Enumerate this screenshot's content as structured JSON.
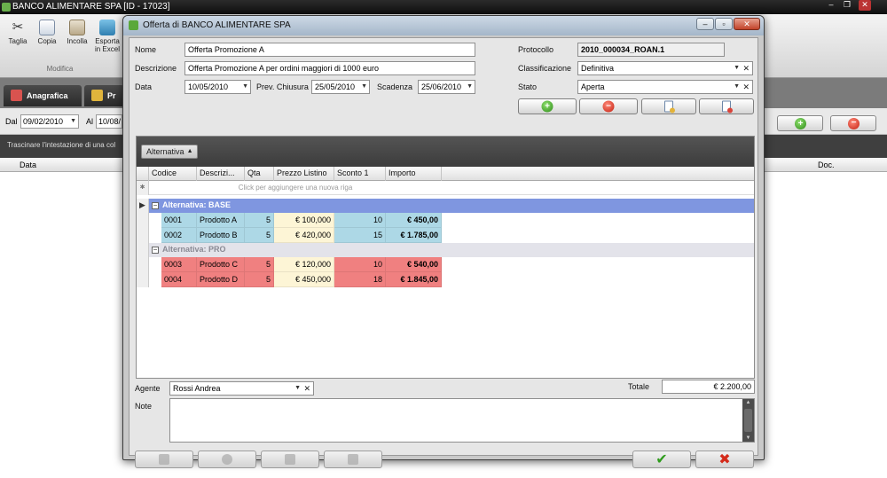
{
  "main_window": {
    "title": "BANCO ALIMENTARE SPA [ID - 17023]",
    "toolbar": {
      "taglia": "Taglia",
      "copia": "Copia",
      "incolla": "Incolla",
      "esporta_l1": "Esporta",
      "esporta_l2": "in Excel",
      "group_label": "Modifica"
    },
    "tabs": {
      "anagrafica": "Anagrafica",
      "second": "Pr"
    },
    "filter": {
      "dal_label": "Dal",
      "dal_value": "09/02/2010",
      "al_label": "Al",
      "al_value": "10/08/"
    },
    "group_hint": "Trascinare l'intestazione di una col",
    "columns": {
      "data": "Data",
      "doc": "Doc."
    }
  },
  "dialog": {
    "title": "Offerta di BANCO ALIMENTARE SPA",
    "nome_label": "Nome",
    "nome_value": "Offerta Promozione A",
    "descrizione_label": "Descrizione",
    "descrizione_value": "Offerta Promozione A per ordini maggiori di 1000 euro",
    "data_label": "Data",
    "data_value": "10/05/2010",
    "prev_chiusura_label": "Prev. Chiusura",
    "prev_chiusura_value": "25/05/2010",
    "scadenza_label": "Scadenza",
    "scadenza_value": "25/06/2010",
    "protocollo_label": "Protocollo",
    "protocollo_value": "2010_000034_ROAN.1",
    "classificazione_label": "Classificazione",
    "classificazione_value": "Definitiva",
    "stato_label": "Stato",
    "stato_value": "Aperta",
    "agente_label": "Agente",
    "agente_value": "Rossi Andrea",
    "totale_label": "Totale",
    "totale_value": "€ 2.200,00",
    "note_label": "Note"
  },
  "grid": {
    "group_chip": "Alternativa",
    "columns": [
      "Codice",
      "Descrizi...",
      "Qta",
      "Prezzo Listino",
      "Sconto 1",
      "Importo"
    ],
    "new_row_hint": "Click per aggiungere una nuova riga",
    "groups": [
      {
        "label": "Alternativa: BASE",
        "color": "#7f96e0",
        "rows": [
          {
            "codice": "0001",
            "descrizione": "Prodotto A",
            "qta": "5",
            "prezzo": "€ 100,000",
            "sconto": "10",
            "importo": "€ 450,00"
          },
          {
            "codice": "0002",
            "descrizione": "Prodotto B",
            "qta": "5",
            "prezzo": "€ 420,000",
            "sconto": "15",
            "importo": "€ 1.785,00"
          }
        ]
      },
      {
        "label": "Alternativa: PRO",
        "color": "#e3e3ea",
        "rows": [
          {
            "codice": "0003",
            "descrizione": "Prodotto C",
            "qta": "5",
            "prezzo": "€ 120,000",
            "sconto": "10",
            "importo": "€ 540,00"
          },
          {
            "codice": "0004",
            "descrizione": "Prodotto D",
            "qta": "5",
            "prezzo": "€ 450,000",
            "sconto": "18",
            "importo": "€ 1.845,00"
          }
        ]
      }
    ]
  },
  "colors": {
    "base_cell": "#add8e6",
    "pro_cell": "#f08080",
    "price_cell": "#fdf5d6",
    "base_header": "#7f96e0",
    "pro_header": "#e3e3ea"
  }
}
